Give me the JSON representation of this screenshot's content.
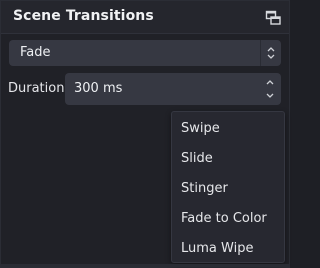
{
  "panel": {
    "title": "Scene Transitions"
  },
  "transition_select": {
    "selected": "Fade"
  },
  "duration": {
    "label": "Duration",
    "value": "300 ms"
  },
  "dropdown_menu": {
    "items": [
      "Swipe",
      "Slide",
      "Stinger",
      "Fade to Color",
      "Luma Wipe"
    ]
  },
  "icons": {
    "undock": "float-window-icon",
    "combo_arrows": "chevron-up-down-icon",
    "spin_up": "chevron-up-icon",
    "spin_down": "chevron-down-icon"
  },
  "colors": {
    "background": "#202127",
    "titlebar": "#25262d",
    "control": "#363842",
    "menu": "#272830",
    "text": "#e6e7ea"
  }
}
